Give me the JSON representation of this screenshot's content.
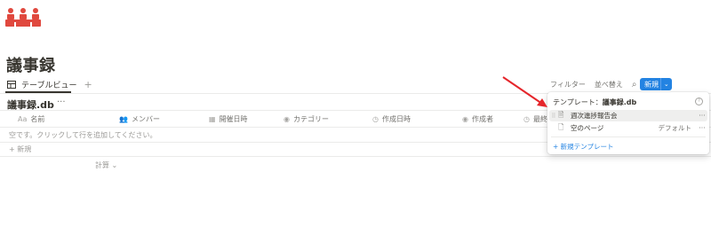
{
  "page": {
    "title": "議事録",
    "logo_icon": "team-people-icon"
  },
  "view_tabs": {
    "active_label": "テーブルビュー",
    "add_icon": "+"
  },
  "toolbar": {
    "filter_label": "フィルター",
    "sort_label": "並べ替え",
    "search_icon": "⌕",
    "expand_icon": "⤢",
    "more_icon": "···",
    "new_label": "新規",
    "new_chevron": "⌄"
  },
  "database": {
    "title": "議事録.db",
    "more_icon": "···"
  },
  "columns": [
    {
      "icon": "Aa",
      "label": "名前"
    },
    {
      "icon": "👥",
      "label": "メンバー"
    },
    {
      "icon": "▦",
      "label": "開催日時"
    },
    {
      "icon": "◉",
      "label": "カテゴリー"
    },
    {
      "icon": "◷",
      "label": "作成日時"
    },
    {
      "icon": "◉",
      "label": "作成者"
    },
    {
      "icon": "◷",
      "label": "最終更"
    }
  ],
  "empty_row_text": "空です。クリックして行を追加してください。",
  "add_row_label": "+ 新規",
  "calculate_label": "計算 ⌄",
  "template_popup": {
    "title_prefix": "テンプレート：",
    "title_db": "議事録.db",
    "help_icon": "?",
    "items": [
      {
        "name": "週次進捗報告会",
        "tag": "",
        "more": "···"
      },
      {
        "name": "空のページ",
        "tag": "デフォルト",
        "more": "···"
      }
    ],
    "new_template_label": "+ 新規テンプレート"
  },
  "colors": {
    "accent": "#2383e2",
    "annotation_arrow": "#e5262b",
    "logo": "#e0483e"
  }
}
